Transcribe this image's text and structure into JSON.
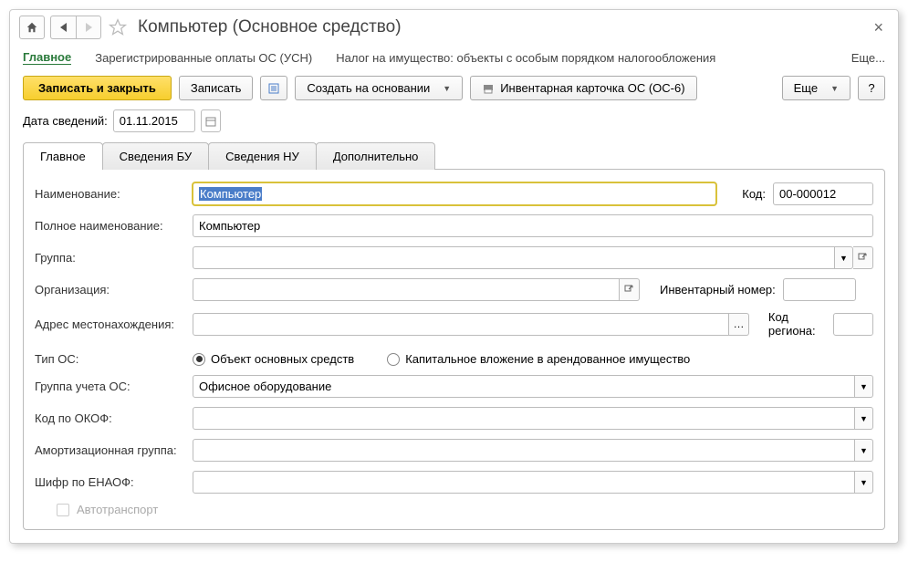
{
  "window": {
    "title": "Компьютер (Основное средство)"
  },
  "menu": {
    "main": "Главное",
    "usn": "Зарегистрированные оплаты ОС (УСН)",
    "tax": "Налог на имущество: объекты с особым порядком налогообложения",
    "more": "Еще..."
  },
  "toolbar": {
    "save_close": "Записать и закрыть",
    "save": "Записать",
    "create_based": "Создать на основании",
    "inv_card": "Инвентарная карточка ОС (ОС-6)",
    "more": "Еще",
    "help": "?"
  },
  "date": {
    "label": "Дата сведений:",
    "value": "01.11.2015"
  },
  "tabs": {
    "main": "Главное",
    "bu": "Сведения БУ",
    "nu": "Сведения НУ",
    "extra": "Дополнительно"
  },
  "form": {
    "name_label": "Наименование:",
    "name_value": "Компьютер",
    "code_label": "Код:",
    "code_value": "00-000012",
    "fullname_label": "Полное наименование:",
    "fullname_value": "Компьютер",
    "group_label": "Группа:",
    "org_label": "Организация:",
    "inv_num_label": "Инвентарный номер:",
    "address_label": "Адрес местонахождения:",
    "region_label": "Код региона:",
    "type_label": "Тип ОС:",
    "type_opt1": "Объект основных средств",
    "type_opt2": "Капитальное вложение в арендованное имущество",
    "group_acc_label": "Группа учета ОС:",
    "group_acc_value": "Офисное оборудование",
    "okof_label": "Код по ОКОФ:",
    "amort_label": "Амортизационная группа:",
    "enaof_label": "Шифр по ЕНАОФ:",
    "auto_label": "Автотранспорт"
  }
}
